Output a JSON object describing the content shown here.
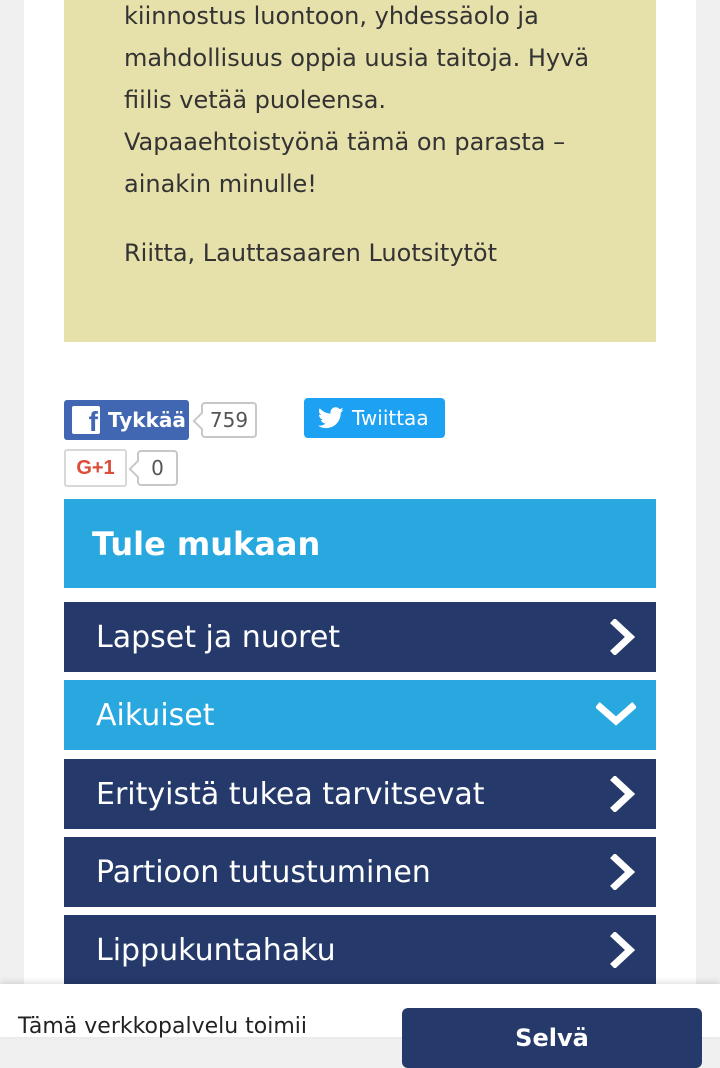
{
  "testimonial": {
    "lines": [
      "kiinnostus luontoon, yhdessäolo ja",
      "mahdollisuus oppia uusia taitoja. Hyvä",
      "fiilis vetää puoleensa.",
      "Vapaaehtoistyönä tämä on parasta –",
      "ainakin minulle!"
    ],
    "signature": "Riitta, Lauttasaaren Luotsitytöt"
  },
  "share": {
    "facebook_label": "Tykkää",
    "facebook_count": "759",
    "twitter_label": "Twiittaa",
    "gplus_label": "G+1",
    "gplus_count": "0"
  },
  "join": {
    "title": "Tule mukaan",
    "items": [
      {
        "label": "Lapset ja nuoret",
        "expanded": false
      },
      {
        "label": "Aikuiset",
        "expanded": true
      },
      {
        "label": "Erityistä tukea tarvitsevat",
        "expanded": false
      },
      {
        "label": "Partioon tutustuminen",
        "expanded": false
      },
      {
        "label": "Lippukuntahaku",
        "expanded": false
      }
    ]
  },
  "cookie": {
    "text": "Tämä verkkopalvelu toimii",
    "button_label": "Selvä"
  },
  "colors": {
    "quote_bg": "#e6e0aa",
    "nav_dark": "#253a6b",
    "nav_active": "#29a8e0",
    "facebook": "#4267b2",
    "twitter": "#1da1f2",
    "gplus": "#dd4b39"
  },
  "icons": {
    "facebook": "facebook-f-icon",
    "twitter": "twitter-bird-icon",
    "chevron_right": "chevron-right-icon",
    "chevron_down": "chevron-down-icon"
  }
}
